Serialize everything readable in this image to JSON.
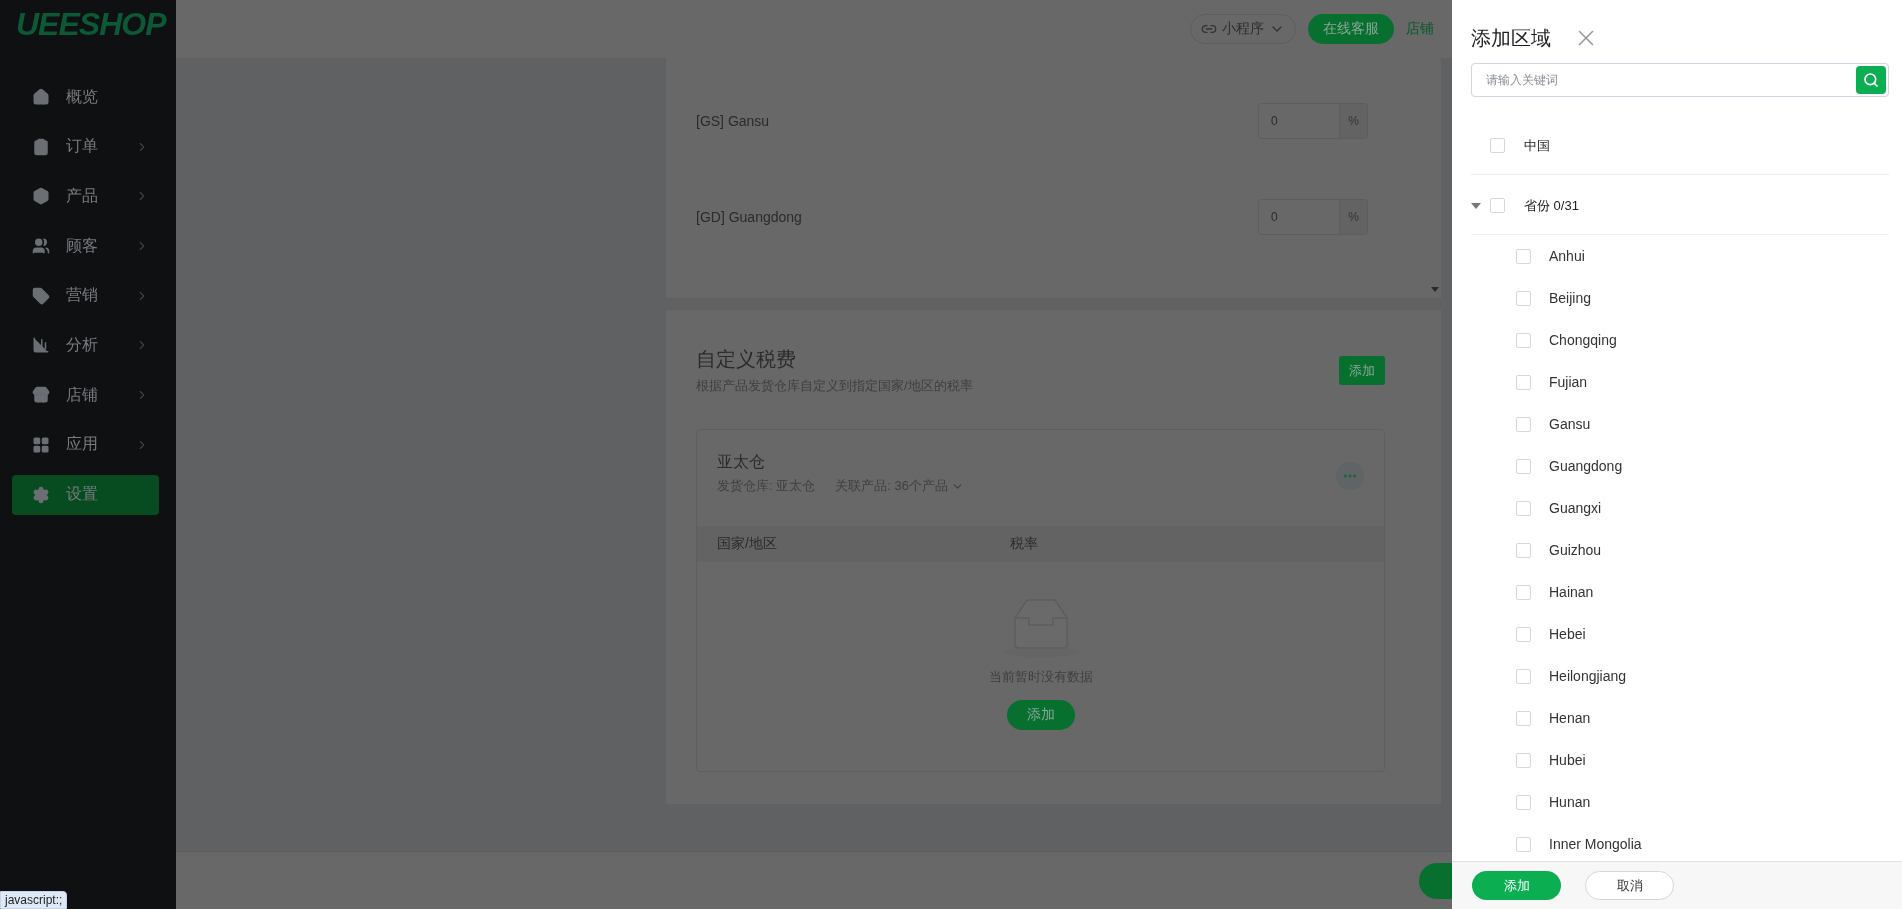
{
  "sidebar": {
    "logo": "UEESHOP",
    "items": [
      {
        "label": "概览",
        "has_submenu": false,
        "selected": false
      },
      {
        "label": "订单",
        "has_submenu": true,
        "selected": false
      },
      {
        "label": "产品",
        "has_submenu": true,
        "selected": false
      },
      {
        "label": "顾客",
        "has_submenu": true,
        "selected": false
      },
      {
        "label": "营销",
        "has_submenu": true,
        "selected": false
      },
      {
        "label": "分析",
        "has_submenu": true,
        "selected": false
      },
      {
        "label": "店铺",
        "has_submenu": true,
        "selected": false
      },
      {
        "label": "应用",
        "has_submenu": true,
        "selected": false
      },
      {
        "label": "设置",
        "has_submenu": false,
        "selected": true
      }
    ]
  },
  "topbar": {
    "mini_program": "小程序",
    "support_button": "在线客服",
    "store_link": "店铺"
  },
  "tax_rows": [
    {
      "label": "[GS] Gansu",
      "value": "0",
      "unit": "%"
    },
    {
      "label": "[GD] Guangdong",
      "value": "0",
      "unit": "%"
    }
  ],
  "custom_tax": {
    "title": "自定义税费",
    "description": "根据产品发货仓库自定义到指定国家/地区的税率",
    "add_button": "添加",
    "warehouse": {
      "name": "亚太仓",
      "warehouse_label": "发货仓库: 亚太仓",
      "products_label": "关联产品: 36个产品",
      "columns": [
        "国家/地区",
        "税率"
      ],
      "empty_text": "当前暂时没有数据",
      "add_button": "添加"
    }
  },
  "status_tooltip": "javascript:;",
  "drawer": {
    "title": "添加区域",
    "search": {
      "placeholder": "请输入关键词"
    },
    "tree": [
      {
        "label": "中国",
        "checked": false
      },
      {
        "label": "省份 0/31",
        "checked": false,
        "expanded": true,
        "children": [
          {
            "label": "Anhui",
            "checked": false
          },
          {
            "label": "Beijing",
            "checked": false
          },
          {
            "label": "Chongqing",
            "checked": false
          },
          {
            "label": "Fujian",
            "checked": false
          },
          {
            "label": "Gansu",
            "checked": false
          },
          {
            "label": "Guangdong",
            "checked": false
          },
          {
            "label": "Guangxi",
            "checked": false
          },
          {
            "label": "Guizhou",
            "checked": false
          },
          {
            "label": "Hainan",
            "checked": false
          },
          {
            "label": "Hebei",
            "checked": false
          },
          {
            "label": "Heilongjiang",
            "checked": false
          },
          {
            "label": "Henan",
            "checked": false
          },
          {
            "label": "Hubei",
            "checked": false
          },
          {
            "label": "Hunan",
            "checked": false
          },
          {
            "label": "Inner Mongolia",
            "checked": false
          }
        ]
      }
    ],
    "confirm_button": "添加",
    "cancel_button": "取消"
  }
}
